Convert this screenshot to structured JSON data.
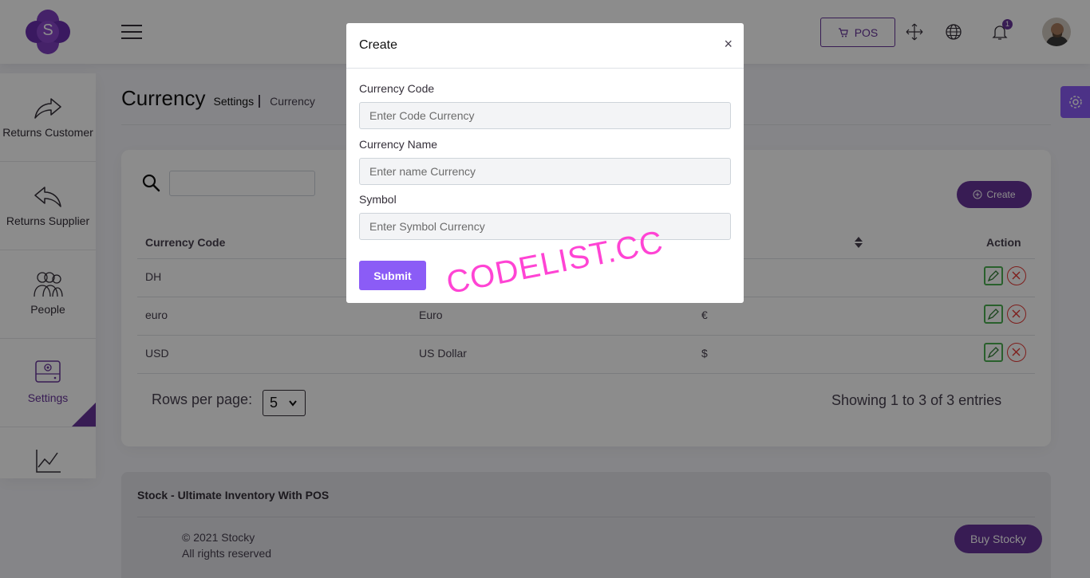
{
  "header": {
    "logo_letter": "S",
    "pos_label": "POS",
    "notification_count": "1"
  },
  "sidebar": {
    "items": [
      {
        "label": "Returns Customer",
        "icon": "share-forward-icon"
      },
      {
        "label": "Returns Supplier",
        "icon": "reply-back-icon"
      },
      {
        "label": "People",
        "icon": "people-icon"
      },
      {
        "label": "Settings",
        "icon": "settings-drive-icon",
        "active": true
      },
      {
        "label": "",
        "icon": "chart-line-icon"
      }
    ]
  },
  "page": {
    "title": "Currency",
    "breadcrumb_parent": "Settings",
    "breadcrumb_current": "Currency"
  },
  "toolbar": {
    "search_value": "",
    "create_label": "Create"
  },
  "table": {
    "headers": [
      "Currency Code",
      "",
      "",
      "Action"
    ],
    "rows": [
      {
        "code": "DH",
        "name": "",
        "symbol": ""
      },
      {
        "code": "euro",
        "name": "Euro",
        "symbol": "€"
      },
      {
        "code": "USD",
        "name": "US Dollar",
        "symbol": "$"
      }
    ]
  },
  "pagination": {
    "rows_label": "Rows per page:",
    "rows_value": "5",
    "showing": "Showing 1 to 3 of 3 entries"
  },
  "footer": {
    "title": "Stock - Ultimate Inventory With POS",
    "copyright": "© 2021 Stocky",
    "rights": "All rights reserved",
    "buy_label": "Buy Stocky"
  },
  "modal": {
    "title": "Create",
    "close": "×",
    "fields": [
      {
        "label": "Currency Code",
        "placeholder": "Enter Code Currency"
      },
      {
        "label": "Currency Name",
        "placeholder": "Enter name Currency"
      },
      {
        "label": "Symbol",
        "placeholder": "Enter Symbol Currency"
      }
    ],
    "submit_label": "Submit"
  },
  "watermark": "CODELIST.CC",
  "colors": {
    "brand": "#663399",
    "accent": "#8b5cf6",
    "edit": "#4caf50",
    "delete": "#e53935"
  }
}
